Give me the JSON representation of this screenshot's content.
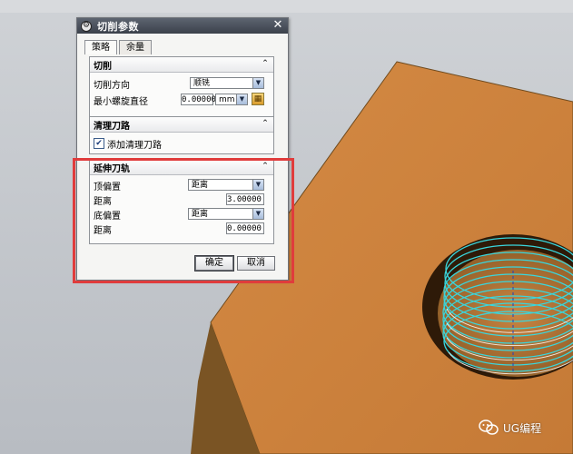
{
  "dialog": {
    "title": "切削参数",
    "tabs": [
      {
        "label": "策略",
        "active": true
      },
      {
        "label": "余量",
        "active": false
      }
    ],
    "cutting": {
      "header": "切削",
      "direction_label": "切削方向",
      "direction_value": "顺铣",
      "min_spiral_label": "最小螺旋直径",
      "min_spiral_value": "0.00000",
      "min_spiral_unit": "mm"
    },
    "cleanup": {
      "header": "清理刀路",
      "add_cleanup_label": "添加清理刀路",
      "add_cleanup_checked": true
    },
    "extend": {
      "header": "延伸刀轨",
      "top_offset_label": "顶偏置",
      "top_offset_value": "距离",
      "top_distance_label": "距离",
      "top_distance_value": "3.00000",
      "bottom_offset_label": "底偏置",
      "bottom_offset_value": "距离",
      "bottom_distance_label": "距离",
      "bottom_distance_value": "0.00000"
    },
    "ok_label": "确定",
    "cancel_label": "取消"
  },
  "watermark": {
    "text": "UG编程",
    "icon": "wechat-icon"
  },
  "colors": {
    "part_face": "#cf8540",
    "part_side": "#7a5424",
    "toolpath": "#39d6dd",
    "highlight_box": "#e03c3c"
  }
}
